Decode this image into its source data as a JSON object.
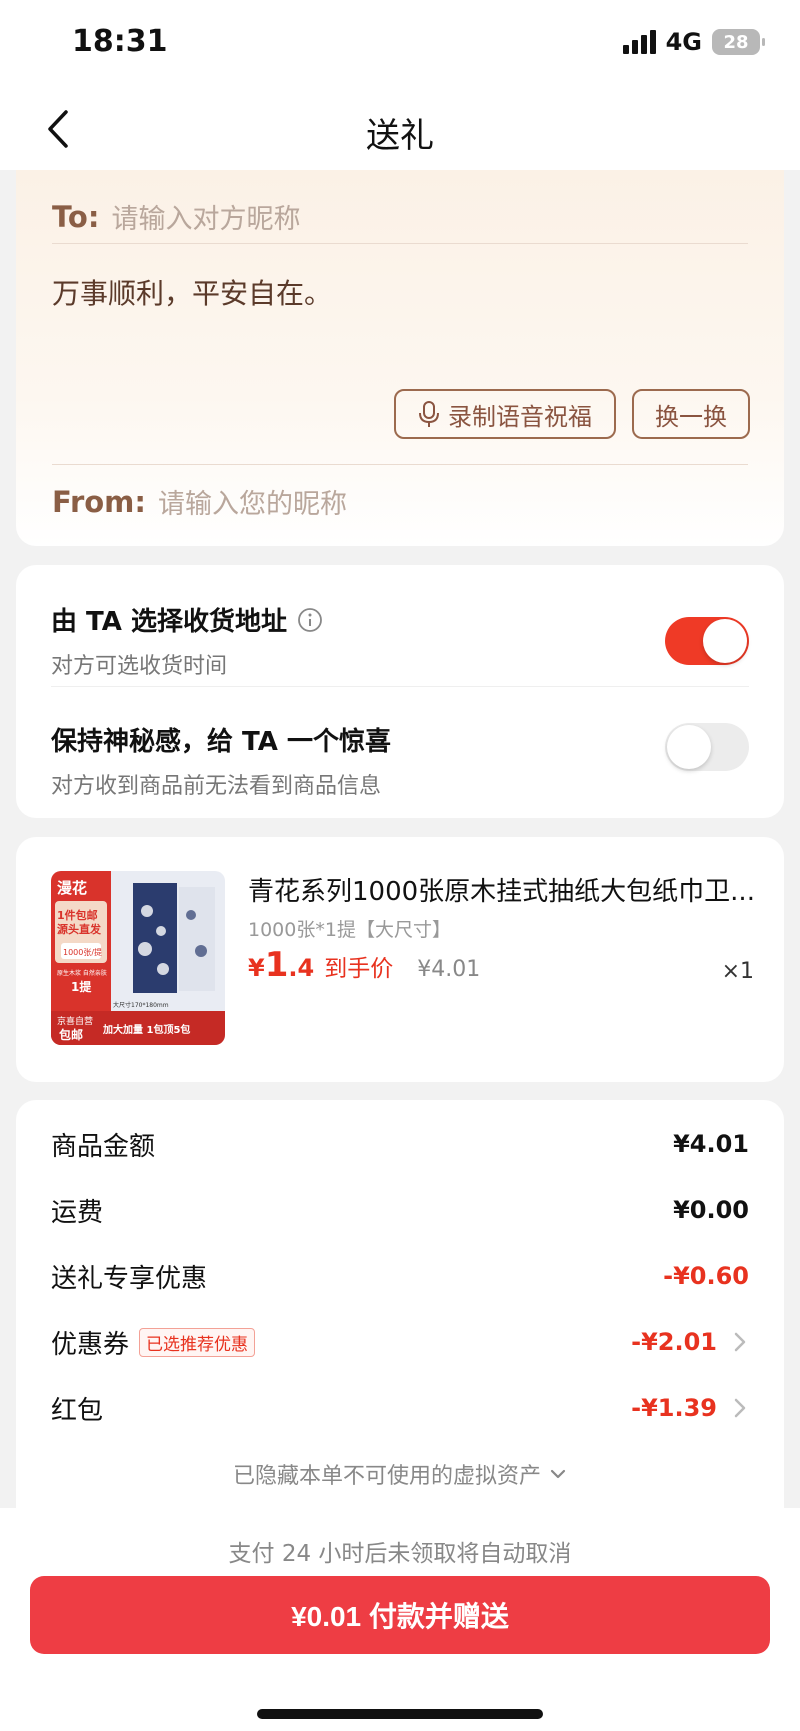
{
  "status": {
    "time": "18:31",
    "network": "4G",
    "battery": "28"
  },
  "nav": {
    "title": "送礼"
  },
  "message": {
    "to_label": "To:",
    "to_placeholder": "请输入对方昵称",
    "text": "万事顺利，平安自在。",
    "voice_button": "录制语音祝福",
    "switch_button": "换一换",
    "from_label": "From:",
    "from_placeholder": "请输入您的昵称"
  },
  "options": [
    {
      "title": "由 TA 选择收货地址",
      "subtitle": "对方可选收货时间",
      "enabled": true
    },
    {
      "title": "保持神秘感，给 TA 一个惊喜",
      "subtitle": "对方收到商品前无法看到商品信息",
      "enabled": false
    }
  ],
  "product": {
    "title": "青花系列1000张原木挂式抽纸大包纸巾卫...",
    "spec": "1000张*1提【大尺寸】",
    "price_symbol": "¥",
    "price_int": "1",
    "price_dec": ".4",
    "price_tag": "到手价",
    "orig_price": "¥4.01",
    "quantity": "×1",
    "thumb": {
      "brand": "漫花",
      "badge_line1": "1件包邮",
      "badge_line2": "源头直发",
      "spec_line": "1000张/提",
      "spec_small": "原生木浆 自然亲肤",
      "count": "1提",
      "size_note": "大尺寸170*180mm",
      "bottom_left_1": "京喜自营",
      "bottom_left_2": "包邮",
      "bottom_right": "加大加量 1包顶5包",
      "colors": {
        "red": "#d9332b",
        "navy": "#2b3c6e",
        "bg": "#e9ecf3"
      }
    }
  },
  "summary": {
    "rows": [
      {
        "label": "商品金额",
        "value": "¥4.01",
        "style": "plain",
        "chevron": false,
        "tag": ""
      },
      {
        "label": "运费",
        "value": "¥0.00",
        "style": "plain",
        "chevron": false,
        "tag": ""
      },
      {
        "label": "送礼专享优惠",
        "value": "-¥0.60",
        "style": "red",
        "chevron": false,
        "tag": ""
      },
      {
        "label": "优惠券",
        "value": "-¥2.01",
        "style": "red",
        "chevron": true,
        "tag": "已选推荐优惠"
      },
      {
        "label": "红包",
        "value": "-¥1.39",
        "style": "red",
        "chevron": true,
        "tag": ""
      }
    ],
    "hidden_note": "已隐藏本单不可使用的虚拟资产"
  },
  "footer": {
    "cancel_note": "支付 24 小时后未领取将自动取消",
    "pay_button": "¥0.01 付款并赠送"
  },
  "colors": {
    "accent": "#e8321f",
    "pay_button": "#ee3d44",
    "toggle_on": "#ef3a26",
    "warm_text": "#8a5e45"
  }
}
